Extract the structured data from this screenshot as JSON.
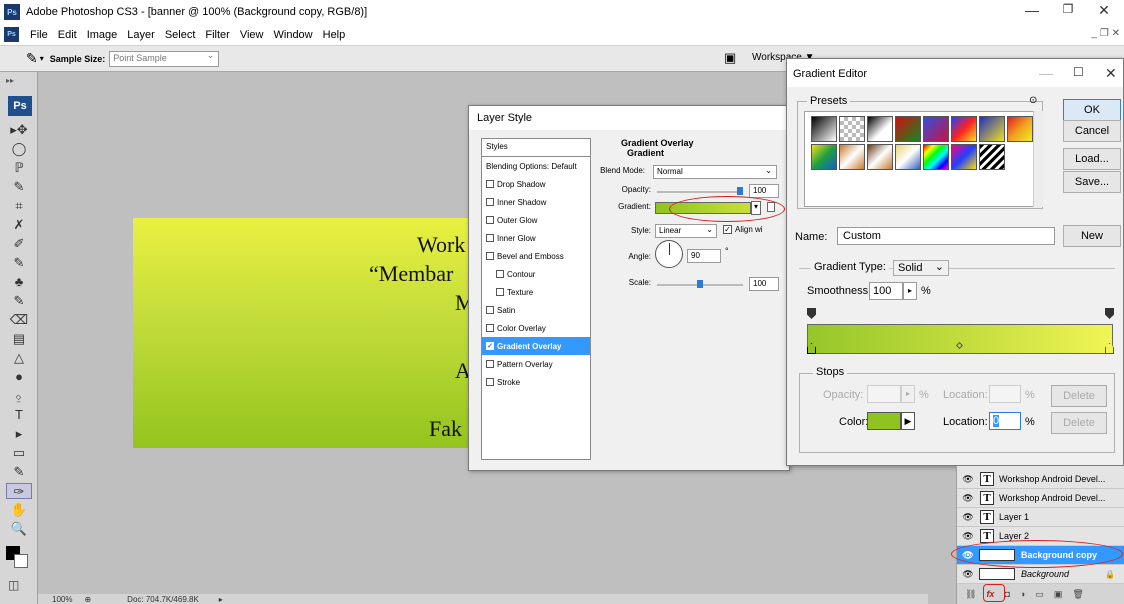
{
  "window": {
    "app_badge": "Ps",
    "title": "Adobe Photoshop CS3 - [banner @ 100% (Background copy, RGB/8)]",
    "minimize": "—",
    "restore": "❐",
    "close": "✕"
  },
  "menu": {
    "items": [
      "File",
      "Edit",
      "Image",
      "Layer",
      "Select",
      "Filter",
      "View",
      "Window",
      "Help"
    ],
    "doc_controls": "_ ❐ ✕"
  },
  "options": {
    "sample_size_label": "Sample Size:",
    "sample_size_value": "Point Sample",
    "workspace_label": "Workspace ▼"
  },
  "toolbar": {
    "badge": "Ps",
    "tools": [
      "▸✥",
      "◯",
      "ℙ",
      "✎",
      "⌗",
      "✗",
      "✐",
      "✎",
      "♣",
      "✎",
      "⌫",
      "▤",
      "△",
      "●",
      "⍚",
      "T",
      "▸",
      "▭",
      "✎",
      "✑",
      "✋",
      "🔍"
    ]
  },
  "canvas": {
    "lines": [
      "Work",
      "“Membar",
      "M",
      "A",
      "Fak"
    ],
    "gradient_colors": [
      "#e9f040",
      "#94c41e"
    ]
  },
  "status": {
    "zoom": "100%",
    "doc": "Doc: 704.7K/469.8K"
  },
  "layer_style": {
    "title": "Layer Style",
    "styles_header": "Styles",
    "items": [
      {
        "label": "Blending Options: Default",
        "checkbox": false,
        "selected": false,
        "indent": false
      },
      {
        "label": "Drop Shadow",
        "checkbox": true,
        "checked": false,
        "selected": false,
        "indent": false
      },
      {
        "label": "Inner Shadow",
        "checkbox": true,
        "checked": false,
        "selected": false,
        "indent": false
      },
      {
        "label": "Outer Glow",
        "checkbox": true,
        "checked": false,
        "selected": false,
        "indent": false
      },
      {
        "label": "Inner Glow",
        "checkbox": true,
        "checked": false,
        "selected": false,
        "indent": false
      },
      {
        "label": "Bevel and Emboss",
        "checkbox": true,
        "checked": false,
        "selected": false,
        "indent": false
      },
      {
        "label": "Contour",
        "checkbox": true,
        "checked": false,
        "selected": false,
        "indent": true
      },
      {
        "label": "Texture",
        "checkbox": true,
        "checked": false,
        "selected": false,
        "indent": true
      },
      {
        "label": "Satin",
        "checkbox": true,
        "checked": false,
        "selected": false,
        "indent": false
      },
      {
        "label": "Color Overlay",
        "checkbox": true,
        "checked": false,
        "selected": false,
        "indent": false
      },
      {
        "label": "Gradient Overlay",
        "checkbox": true,
        "checked": true,
        "selected": true,
        "indent": false
      },
      {
        "label": "Pattern Overlay",
        "checkbox": true,
        "checked": false,
        "selected": false,
        "indent": false
      },
      {
        "label": "Stroke",
        "checkbox": true,
        "checked": false,
        "selected": false,
        "indent": false
      }
    ],
    "section_title": "Gradient Overlay",
    "subsection_title": "Gradient",
    "blend_mode_label": "Blend Mode:",
    "blend_mode_value": "Normal",
    "opacity_label": "Opacity:",
    "opacity_value": "100",
    "gradient_label": "Gradient:",
    "style_label": "Style:",
    "style_value": "Linear",
    "align_label": "Align wi",
    "angle_label": "Angle:",
    "angle_value": "90",
    "angle_unit": "°",
    "scale_label": "Scale:",
    "scale_value": "100",
    "opacity_level": 1.0,
    "scale_level": 0.5
  },
  "gradient_editor": {
    "title": "Gradient Editor",
    "presets_label": "Presets",
    "presets": [
      "linear-gradient(135deg,#000,#fff)",
      "repeating-conic-gradient(#bbb 0 25%,#fff 0 50%) 0 0/8px 8px",
      "linear-gradient(135deg,#000,#fff 60%,transparent)",
      "linear-gradient(135deg,#d01010,#108a20)",
      "linear-gradient(135deg,#3050e0,#d01040)",
      "linear-gradient(135deg,#2040ff,#ff2020,#ffe020)",
      "linear-gradient(135deg,#2030c0,#f0e020)",
      "linear-gradient(135deg,#e02020,#f0a020,#f0f020)",
      "linear-gradient(135deg,#f0e020,#20a040,#1060d0)",
      "linear-gradient(135deg,#c87a30,#fff,#c87a30)",
      "linear-gradient(135deg,#6a3a1a,#fff,#c87a30)",
      "linear-gradient(135deg,#e9d37c,#fff,#3060c0)",
      "linear-gradient(135deg,#ff0000,#ffff00,#00ff00,#00ffff,#0000ff,#ff00ff)",
      "linear-gradient(135deg,#ff0080,#2040ff,#ffe000)",
      "repeating-linear-gradient(135deg,#000 0 3px,#fff 3px 6px)"
    ],
    "buttons": {
      "ok": "OK",
      "cancel": "Cancel",
      "load": "Load...",
      "save": "Save...",
      "new": "New",
      "delete": "Delete"
    },
    "name_label": "Name:",
    "name_value": "Custom",
    "gradient_type_label": "Gradient Type:",
    "gradient_type_value": "Solid",
    "smoothness_label": "Smoothness:",
    "smoothness_value": "100",
    "percent": "%",
    "stops_label": "Stops",
    "opacity_label": "Opacity:",
    "location_label": "Location:",
    "color_label": "Color:",
    "stop_color": "#8fc31f",
    "gradient_colors": [
      "#96c62a",
      "#f0f555"
    ],
    "location_value": "0"
  },
  "layers": {
    "items": [
      {
        "label": "Workshop Android Devel...",
        "type": "text",
        "selected": false
      },
      {
        "label": "Workshop Android Devel...",
        "type": "text",
        "selected": false
      },
      {
        "label": "Layer 1",
        "type": "text",
        "selected": false
      },
      {
        "label": "Layer 2",
        "type": "text",
        "selected": false
      },
      {
        "label": "Background copy",
        "type": "image",
        "selected": true
      },
      {
        "label": "Background",
        "type": "image",
        "selected": false
      }
    ],
    "footer_fx": "fx"
  },
  "highlight_color": "#d81e1e",
  "selection_color": "#3399ff"
}
